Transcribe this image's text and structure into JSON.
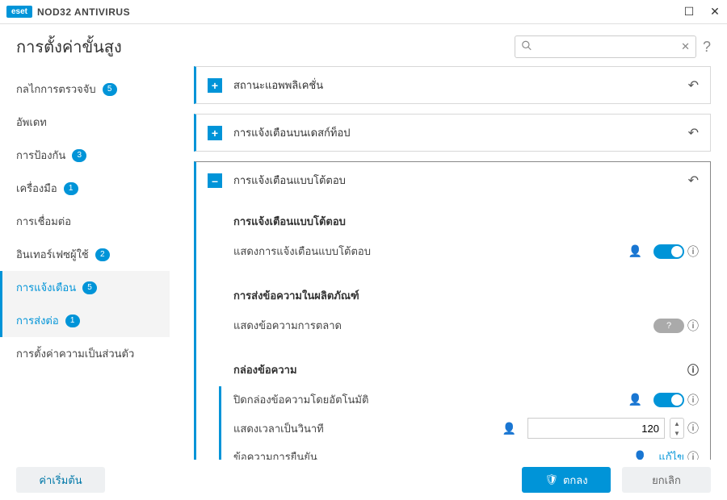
{
  "window": {
    "app_badge": "eset",
    "app_title": "NOD32 ANTIVIRUS"
  },
  "header": {
    "title": "การตั้งค่าขั้นสูง",
    "search_placeholder": ""
  },
  "sidebar": {
    "items": [
      {
        "label": "กลไกการตรวจจับ",
        "badge": "5",
        "active": false
      },
      {
        "label": "อัพเดท",
        "badge": null,
        "active": false
      },
      {
        "label": "การป้องกัน",
        "badge": "3",
        "active": false
      },
      {
        "label": "เครื่องมือ",
        "badge": "1",
        "active": false
      },
      {
        "label": "การเชื่อมต่อ",
        "badge": null,
        "active": false
      },
      {
        "label": "อินเทอร์เฟซผู้ใช้",
        "badge": "2",
        "active": false
      },
      {
        "label": "การแจ้งเตือน",
        "badge": "5",
        "active": true
      },
      {
        "label": "การส่งต่อ",
        "badge": "1",
        "active": true,
        "sub": true
      },
      {
        "label": "การตั้งค่าความเป็นส่วนตัว",
        "badge": null,
        "active": false
      }
    ]
  },
  "panels": [
    {
      "title": "สถานะแอพพลิเคชั่น",
      "expanded": false
    },
    {
      "title": "การแจ้งเตือนบนเดสก์ท็อป",
      "expanded": false
    },
    {
      "title": "การแจ้งเตือนแบบโต้ตอบ",
      "expanded": true
    }
  ],
  "interactive": {
    "section1_title": "การแจ้งเตือนแบบโต้ตอบ",
    "row1_label": "แสดงการแจ้งเตือนแบบโต้ตอบ",
    "section2_title": "การส่งข้อความในผลิตภัณฑ์",
    "row2_label": "แสดงข้อความการตลาด",
    "row2_icon": "?",
    "section3_title": "กล่องข้อความ",
    "row3_label": "ปิดกล่องข้อความโดยอัตโนมัติ",
    "row4_label": "แสดงเวลาเป็นวินาที",
    "row4_value": "120",
    "row5_label": "ข้อความการยืนยัน",
    "row5_link": "แก้ไข"
  },
  "footer": {
    "default_btn": "ค่าเริ่มต้น",
    "ok_btn": "ตกลง",
    "cancel_btn": "ยกเลิก"
  }
}
